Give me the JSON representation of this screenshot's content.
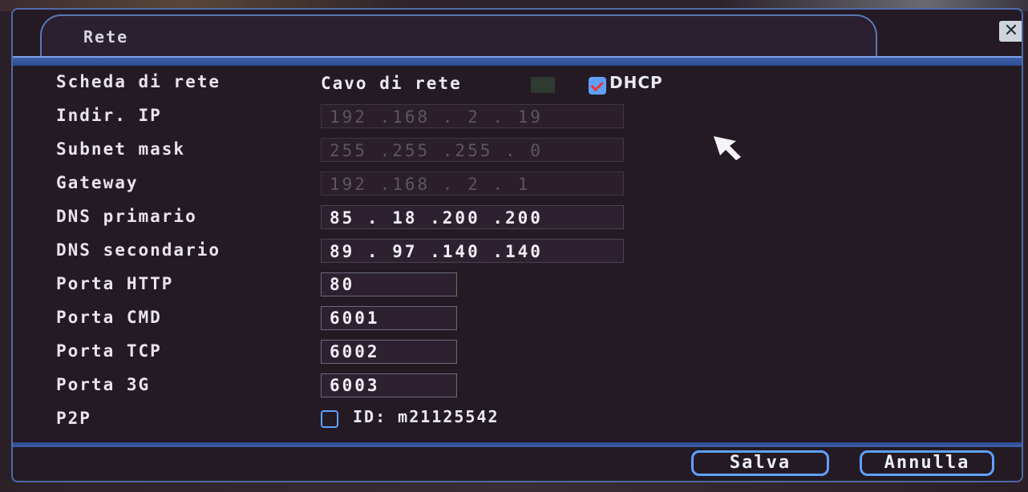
{
  "window": {
    "title": "Rete",
    "close_symbol": "✕"
  },
  "network_card": {
    "label": "Scheda di rete",
    "value": "Cavo di rete",
    "dhcp_label": "DHCP",
    "dhcp_checked": true
  },
  "ip_fields": [
    {
      "label": "Indir. IP",
      "value": "192 .168 .  2 . 19",
      "enabled": false
    },
    {
      "label": "Subnet mask",
      "value": "255 .255 .255 .  0",
      "enabled": false
    },
    {
      "label": "Gateway",
      "value": "192 .168 .  2 .  1",
      "enabled": false
    },
    {
      "label": "DNS primario",
      "value": " 85 . 18 .200 .200",
      "enabled": true
    },
    {
      "label": "DNS secondario",
      "value": " 89 . 97 .140 .140",
      "enabled": true
    }
  ],
  "ports": [
    {
      "label": "Porta HTTP",
      "value": "80"
    },
    {
      "label": "Porta CMD",
      "value": "6001"
    },
    {
      "label": "Porta TCP",
      "value": "6002"
    },
    {
      "label": "Porta 3G",
      "value": "6003"
    }
  ],
  "p2p": {
    "label": "P2P",
    "checked": false,
    "id_text": "ID: m21125542"
  },
  "buttons": {
    "save": "Salva",
    "cancel": "Annulla"
  },
  "colors": {
    "accent": "#5fa0ff",
    "border": "#4f6aa8",
    "background": "#241a23"
  }
}
